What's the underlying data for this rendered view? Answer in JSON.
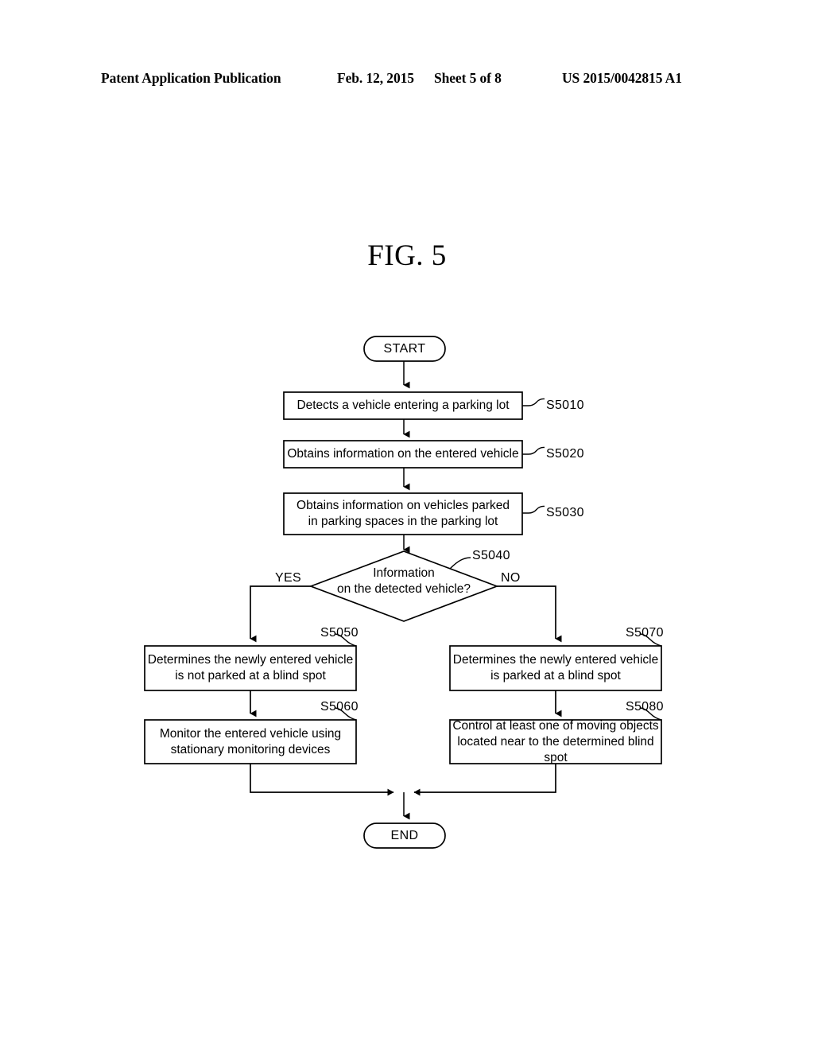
{
  "header": {
    "publication": "Patent Application Publication",
    "date": "Feb. 12, 2015",
    "sheet": "Sheet 5 of 8",
    "patent_number": "US 2015/0042815 A1"
  },
  "figure": {
    "title": "FIG. 5"
  },
  "flowchart": {
    "start": {
      "label": "START"
    },
    "end": {
      "label": "END"
    },
    "steps": [
      {
        "id": "S5010",
        "text": "Detects a vehicle entering a parking lot"
      },
      {
        "id": "S5020",
        "text": "Obtains information on the entered vehicle"
      },
      {
        "id": "S5030",
        "text": "Obtains information on vehicles parked\nin parking spaces in the parking lot"
      },
      {
        "id": "S5040",
        "text": "Information\non the detected vehicle?"
      },
      {
        "id": "S5050",
        "text": "Determines the newly entered vehicle\nis not parked at a blind spot"
      },
      {
        "id": "S5060",
        "text": "Monitor the entered vehicle using\nstationary monitoring devices"
      },
      {
        "id": "S5070",
        "text": "Determines the newly entered vehicle\nis parked at a blind spot"
      },
      {
        "id": "S5080",
        "text": "Control at least one of moving objects\nlocated near to the determined blind spot"
      }
    ],
    "branches": {
      "yes": "YES",
      "no": "NO"
    }
  }
}
